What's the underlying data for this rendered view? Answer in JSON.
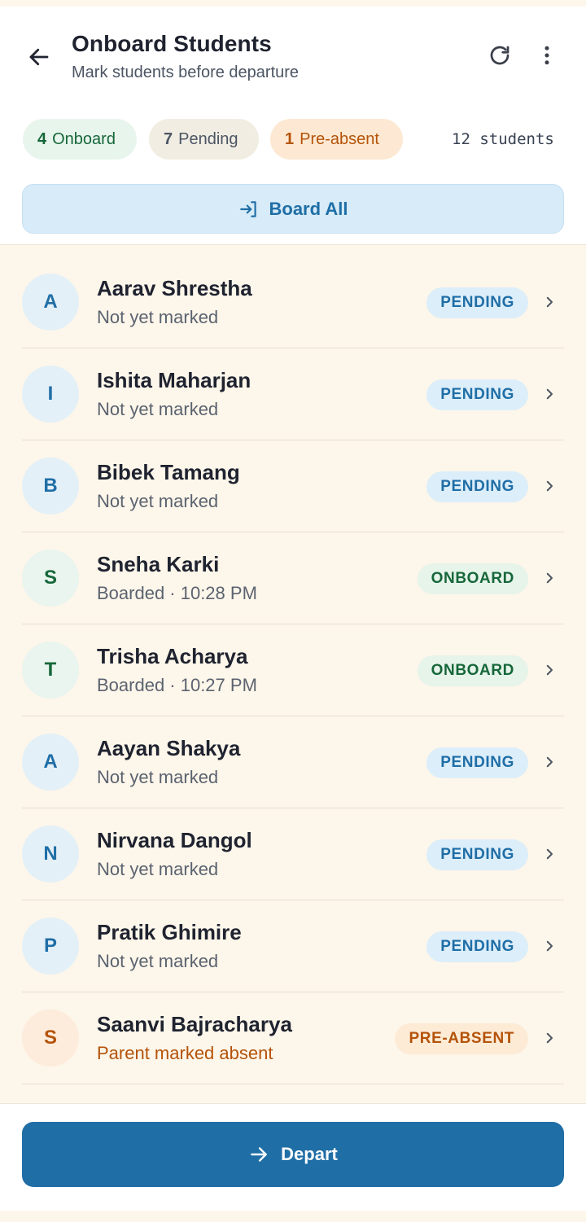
{
  "header": {
    "title": "Onboard Students",
    "subtitle": "Mark students before departure"
  },
  "summary": {
    "onboard_count": "4",
    "onboard_label": "Onboard",
    "pending_count": "7",
    "pending_label": "Pending",
    "preabsent_count": "1",
    "preabsent_label": "Pre-absent",
    "total": "12 students"
  },
  "actions": {
    "board_all": "Board All",
    "depart": "Depart"
  },
  "students": [
    {
      "initial": "A",
      "name": "Aarav Shrestha",
      "status_text": "Not yet marked",
      "badge": "PENDING",
      "status": "pending"
    },
    {
      "initial": "I",
      "name": "Ishita Maharjan",
      "status_text": "Not yet marked",
      "badge": "PENDING",
      "status": "pending"
    },
    {
      "initial": "B",
      "name": "Bibek Tamang",
      "status_text": "Not yet marked",
      "badge": "PENDING",
      "status": "pending"
    },
    {
      "initial": "S",
      "name": "Sneha Karki",
      "status_text": "Boarded · 10:28 PM",
      "badge": "ONBOARD",
      "status": "onboard"
    },
    {
      "initial": "T",
      "name": "Trisha Acharya",
      "status_text": "Boarded · 10:27 PM",
      "badge": "ONBOARD",
      "status": "onboard"
    },
    {
      "initial": "A",
      "name": "Aayan Shakya",
      "status_text": "Not yet marked",
      "badge": "PENDING",
      "status": "pending"
    },
    {
      "initial": "N",
      "name": "Nirvana Dangol",
      "status_text": "Not yet marked",
      "badge": "PENDING",
      "status": "pending"
    },
    {
      "initial": "P",
      "name": "Pratik Ghimire",
      "status_text": "Not yet marked",
      "badge": "PENDING",
      "status": "pending"
    },
    {
      "initial": "S",
      "name": "Saanvi Bajracharya",
      "status_text": "Parent marked absent",
      "badge": "PRE-ABSENT",
      "status": "preabsent"
    }
  ],
  "colors": {
    "primary": "#1f6ea6",
    "onboard": "#16673a",
    "preabsent": "#b45309",
    "background": "#fdf6ea"
  }
}
